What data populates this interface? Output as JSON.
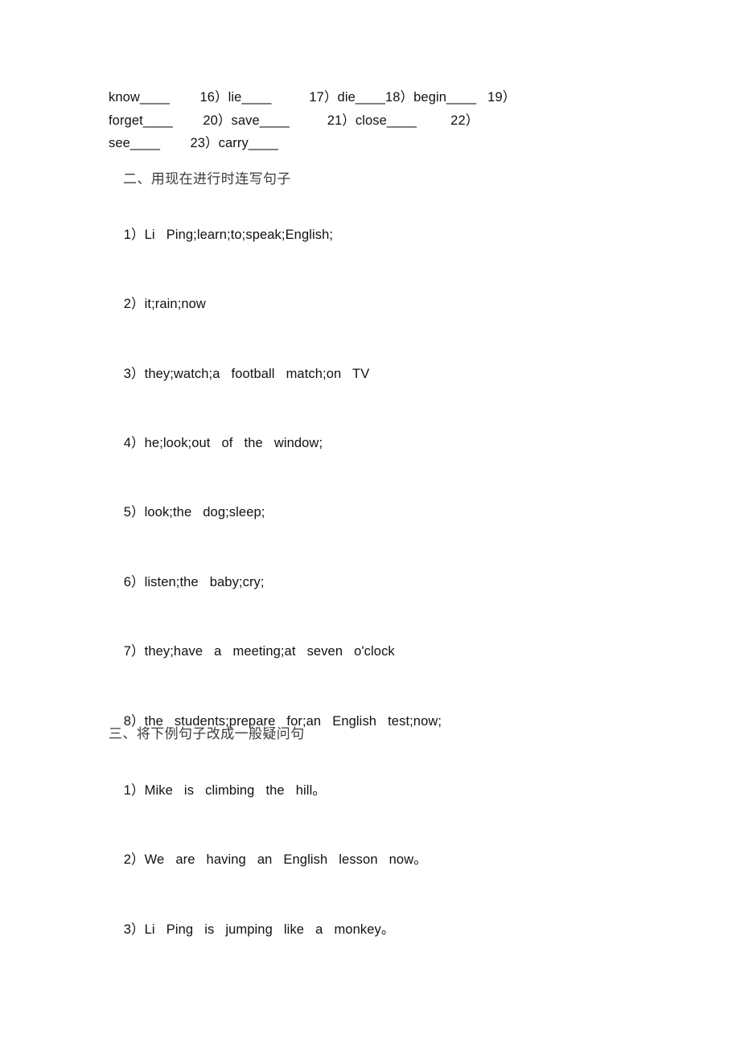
{
  "document": {
    "kind": "english-grammar-worksheet",
    "page_background": "#ffffff",
    "text_color": "#111111",
    "heading_color": "#3d3d3d"
  },
  "wordlist": {
    "lines": [
      "know____        16）lie____          17）die____18）begin____   19）",
      "forget____        20）save____          21）close____         22）",
      "see____        23）carry____"
    ]
  },
  "sections": [
    {
      "id": "section-two",
      "heading": "二、用现在进行时连写句子",
      "items": [
        {
          "num": "1）",
          "text": "Li   Ping;learn;to;speak;English;"
        },
        {
          "num": "2）",
          "text": "it;rain;now"
        },
        {
          "num": "3）",
          "text": "they;watch;a   football   match;on   TV"
        },
        {
          "num": "4）",
          "text": "he;look;out   of   the   window;"
        },
        {
          "num": "5）",
          "text": "look;the   dog;sleep;"
        },
        {
          "num": "6）",
          "text": "listen;the   baby;cry;"
        },
        {
          "num": "7）",
          "text": "they;have   a   meeting;at   seven   o'clock"
        },
        {
          "num": "8）",
          "text": "the   students;prepare   for;an   English   test;now;"
        }
      ]
    },
    {
      "id": "section-three",
      "heading": "三、将下例句子改成一般疑问句",
      "items": [
        {
          "num": "1）",
          "text": "Mike   is   climbing   the   hill。"
        },
        {
          "num": "2）",
          "text": "We   are   having   an   English   lesson   now。"
        },
        {
          "num": "3）",
          "text": "Li   Ping   is   jumping   like   a   monkey。"
        }
      ]
    }
  ],
  "layout": {
    "section_two_item_tops": [
      256,
      342,
      429,
      515,
      601,
      688,
      774,
      861
    ],
    "section_three_item_tops": [
      947,
      1033,
      1120
    ]
  }
}
